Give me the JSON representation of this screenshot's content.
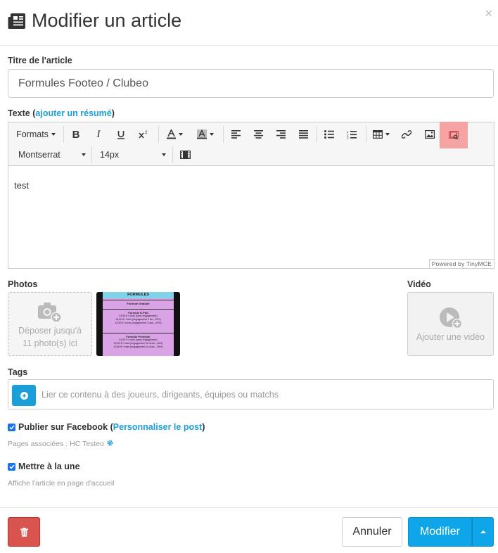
{
  "modal": {
    "title": "Modifier un article",
    "close": "×"
  },
  "title_field": {
    "label": "Titre de l'article",
    "value": "Formules Footeo / Clubeo"
  },
  "text_field": {
    "label": "Texte",
    "paren_open": "(",
    "summary_link": "ajouter un résumé",
    "paren_close": ")",
    "content": "test",
    "powered_by": "Powered by TinyMCE"
  },
  "toolbar": {
    "formats": "Formats",
    "font_family": "Montserrat",
    "font_size": "14px"
  },
  "photos": {
    "label": "Photos",
    "dropzone_text": "Déposer jusqu'à 11 photo(s) ici",
    "thumbnail": {
      "heading": "FORMULES",
      "rows": [
        {
          "title": "Formule Gratuite",
          "lines": []
        },
        {
          "title": "Formule E-Pub",
          "lines": [
            "24,90 € / mois (sans engagement)",
            "16,60 € / mois (engagement 1 an, -33%)",
            "14,90 € / mois (engagement 2 ans, -25%)"
          ]
        },
        {
          "title": "Formule Premium",
          "lines": [
            "44,90 € / mois (sans engagement)",
            "39,90 € / mois (engagement 12 mois, -15%)",
            "29,90 € / mois (engagement 24 mois, -35%)"
          ]
        }
      ]
    }
  },
  "video": {
    "label": "Vidéo",
    "add_text": "Ajouter une vidéo"
  },
  "tags": {
    "label": "Tags",
    "placeholder": "Lier ce contenu à des joueurs, dirigeants, équipes ou matchs"
  },
  "facebook": {
    "label": "Publier sur Facebook",
    "paren_open": "(",
    "link": "Personnaliser le post",
    "paren_close": ")",
    "pages": "Pages associées : HC Testeo",
    "checked": true
  },
  "featured": {
    "label": "Mettre à la une",
    "hint": "Affiche l'article en page d'accueil",
    "checked": true
  },
  "footer": {
    "cancel": "Annuler",
    "modify": "Modifier"
  },
  "colors": {
    "accent": "#1a9fd9",
    "primary_button": "#0ea5e9",
    "danger": "#d9534f",
    "highlight": "#f5a3a3"
  }
}
